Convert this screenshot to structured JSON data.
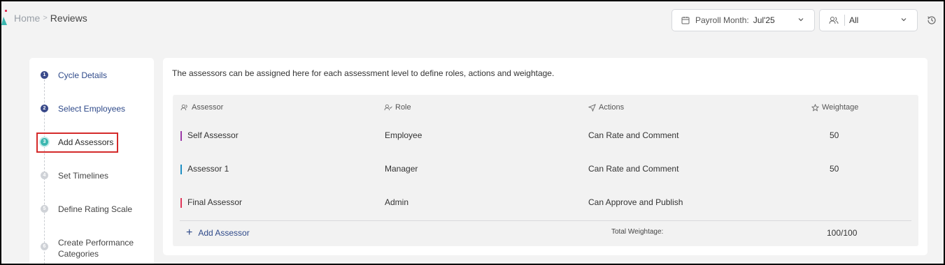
{
  "breadcrumb": {
    "home": "Home",
    "separator": ">",
    "current": "Reviews"
  },
  "header": {
    "payroll": {
      "label": "Payroll Month:",
      "value": "Jul'25",
      "icon": "calendar-icon"
    },
    "group": {
      "value": "All",
      "icon": "users-icon"
    },
    "history_icon": "history-icon"
  },
  "steps": [
    {
      "num": "1",
      "label": "Cycle Details",
      "state": "done"
    },
    {
      "num": "2",
      "label": "Select Employees",
      "state": "done"
    },
    {
      "num": "3",
      "label": "Add Assessors",
      "state": "active"
    },
    {
      "num": "4",
      "label": "Set Timelines",
      "state": "todo"
    },
    {
      "num": "5",
      "label": "Define Rating Scale",
      "state": "todo"
    },
    {
      "num": "6",
      "label": "Create Performance Categories",
      "state": "todo"
    }
  ],
  "main": {
    "intro": "The assessors can be assigned here for each assessment level to define roles, actions and weightage.",
    "columns": {
      "assessor": "Assessor",
      "role": "Role",
      "actions": "Actions",
      "weightage": "Weightage"
    },
    "rows": [
      {
        "assessor": "Self Assessor",
        "role": "Employee",
        "action": "Can Rate and Comment",
        "weightage": "50",
        "color": "#9b3aa8"
      },
      {
        "assessor": "Assessor 1",
        "role": "Manager",
        "action": "Can Rate and Comment",
        "weightage": "50",
        "color": "#1e8fc4"
      },
      {
        "assessor": "Final Assessor",
        "role": "Admin",
        "action": "Can Approve and Publish",
        "weightage": "",
        "color": "#e0375a"
      }
    ],
    "add_assessor": "Add Assessor",
    "total_label": "Total Weightage:",
    "total_value": "100/100"
  }
}
